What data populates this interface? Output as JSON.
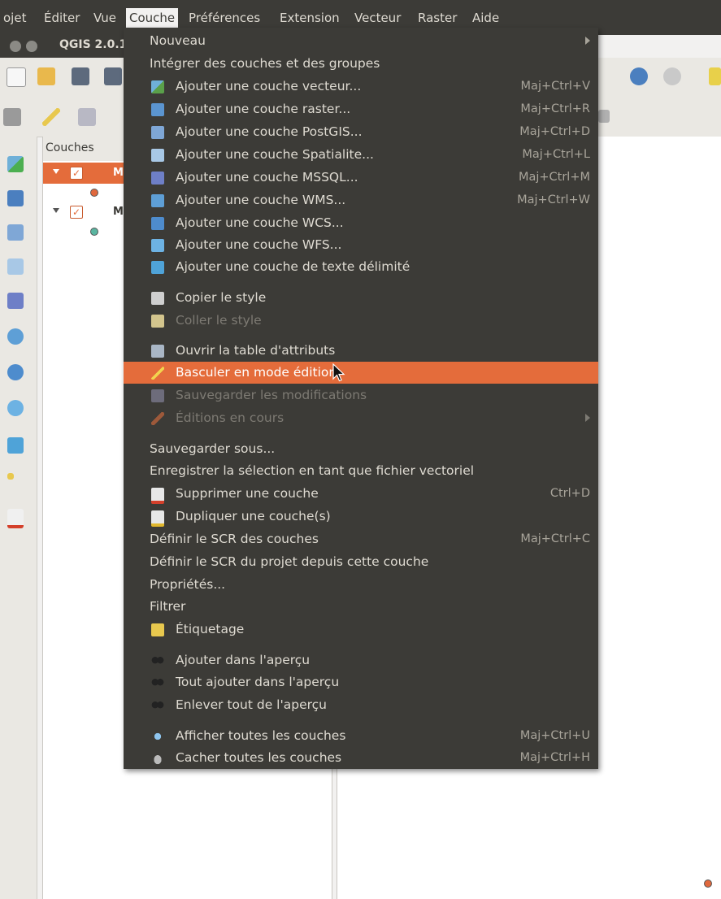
{
  "menubar": {
    "items": [
      "ojet",
      "Éditer",
      "Vue",
      "Couche",
      "Préférences",
      "Extension",
      "Vecteur",
      "Raster",
      "Aide"
    ]
  },
  "window": {
    "title": "QGIS 2.0.1"
  },
  "layers_panel": {
    "title": "Couches",
    "layers": [
      {
        "name": "M",
        "selected": true
      },
      {
        "name": "M",
        "selected": false
      }
    ]
  },
  "colors": {
    "accent": "#e46c3b",
    "menu_bg": "#3c3b37",
    "menu_text": "#dfdbd2"
  },
  "menu": {
    "items": [
      {
        "label": "Nouveau",
        "shortcut": "",
        "submenu": true
      },
      {
        "label": "Intégrer des couches et des groupes",
        "shortcut": ""
      },
      {
        "label": "Ajouter une couche vecteur...",
        "shortcut": "Maj+Ctrl+V",
        "icon": "add-vector-layer-icon"
      },
      {
        "label": "Ajouter une couche raster...",
        "shortcut": "Maj+Ctrl+R",
        "icon": "add-raster-layer-icon"
      },
      {
        "label": "Ajouter une couche PostGIS...",
        "shortcut": "Maj+Ctrl+D",
        "icon": "add-postgis-layer-icon"
      },
      {
        "label": "Ajouter une couche Spatialite...",
        "shortcut": "Maj+Ctrl+L",
        "icon": "add-spatialite-layer-icon"
      },
      {
        "label": "Ajouter une couche MSSQL...",
        "shortcut": "Maj+Ctrl+M",
        "icon": "add-mssql-layer-icon"
      },
      {
        "label": "Ajouter une couche WMS...",
        "shortcut": "Maj+Ctrl+W",
        "icon": "add-wms-layer-icon"
      },
      {
        "label": "Ajouter une couche WCS...",
        "shortcut": "",
        "icon": "add-wcs-layer-icon"
      },
      {
        "label": "Ajouter une couche WFS...",
        "shortcut": "",
        "icon": "add-wfs-layer-icon"
      },
      {
        "label": "Ajouter une couche de texte délimité",
        "shortcut": "",
        "icon": "add-delimited-text-icon"
      },
      {
        "label": "Copier le style",
        "shortcut": "",
        "icon": "copy-style-icon"
      },
      {
        "label": "Coller le style",
        "shortcut": "",
        "icon": "paste-style-icon",
        "disabled": true
      },
      {
        "label": "Ouvrir la table d'attributs",
        "shortcut": "",
        "icon": "attribute-table-icon"
      },
      {
        "label": "Basculer en mode édition",
        "shortcut": "",
        "icon": "toggle-editing-icon",
        "highlighted": true
      },
      {
        "label": "Sauvegarder les modifications",
        "shortcut": "",
        "icon": "save-edits-icon",
        "disabled": true
      },
      {
        "label": "Éditions en cours",
        "shortcut": "",
        "icon": "current-edits-icon",
        "disabled": true,
        "submenu": true
      },
      {
        "label": "Sauvegarder sous...",
        "shortcut": ""
      },
      {
        "label": "Enregistrer la sélection en tant que fichier vectoriel",
        "shortcut": ""
      },
      {
        "label": "Supprimer une couche",
        "shortcut": "Ctrl+D",
        "icon": "remove-layer-icon"
      },
      {
        "label": "Dupliquer une couche(s)",
        "shortcut": "",
        "icon": "duplicate-layer-icon"
      },
      {
        "label": "Définir le SCR des couches",
        "shortcut": "Maj+Ctrl+C"
      },
      {
        "label": "Définir le SCR du projet depuis cette couche",
        "shortcut": ""
      },
      {
        "label": "Propriétés...",
        "shortcut": ""
      },
      {
        "label": "Filtrer",
        "shortcut": ""
      },
      {
        "label": "Étiquetage",
        "shortcut": "",
        "icon": "labeling-icon"
      },
      {
        "label": "Ajouter dans l'aperçu",
        "shortcut": "",
        "icon": "add-to-overview-icon"
      },
      {
        "label": "Tout ajouter dans l'aperçu",
        "shortcut": "",
        "icon": "add-all-to-overview-icon"
      },
      {
        "label": "Enlever tout de l'aperçu",
        "shortcut": "",
        "icon": "remove-all-from-overview-icon"
      },
      {
        "label": "Afficher toutes les couches",
        "shortcut": "Maj+Ctrl+U",
        "icon": "show-all-layers-icon"
      },
      {
        "label": "Cacher toutes les couches",
        "shortcut": "Maj+Ctrl+H",
        "icon": "hide-all-layers-icon"
      }
    ]
  }
}
